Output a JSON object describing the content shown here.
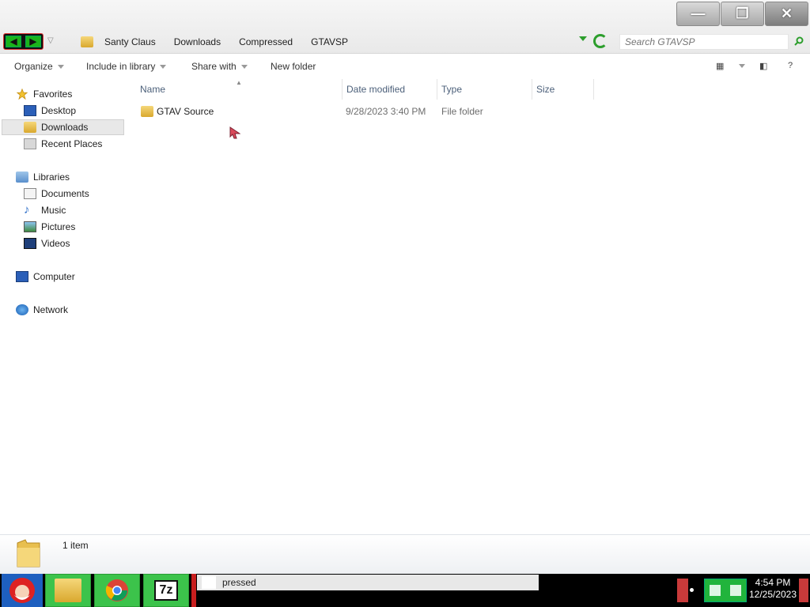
{
  "address_bar": {
    "breadcrumbs": [
      "Santy Claus",
      "Downloads",
      "Compressed",
      "GTAVSP"
    ],
    "search_placeholder": "Search GTAVSP"
  },
  "window_controls": {
    "minimize": "—",
    "restore": "❐",
    "close": "✕"
  },
  "nav_buttons": {
    "back": "◀",
    "forward": "▶"
  },
  "command_bar": {
    "organize": "Organize",
    "include_in_library": "Include in library",
    "share_with": "Share with",
    "new_folder": "New folder",
    "help": "?"
  },
  "navigation": {
    "favorites": {
      "label": "Favorites",
      "items": [
        {
          "label": "Desktop",
          "icon": "desktop-icon"
        },
        {
          "label": "Downloads",
          "icon": "downloads-folder-icon",
          "selected": true
        },
        {
          "label": "Recent Places",
          "icon": "recent-places-icon"
        }
      ]
    },
    "libraries": {
      "label": "Libraries",
      "items": [
        {
          "label": "Documents",
          "icon": "documents-icon"
        },
        {
          "label": "Music",
          "icon": "music-icon"
        },
        {
          "label": "Pictures",
          "icon": "pictures-icon"
        },
        {
          "label": "Videos",
          "icon": "videos-icon"
        }
      ]
    },
    "computer": "Computer",
    "network": "Network"
  },
  "file_list": {
    "columns": [
      "Name",
      "Date modified",
      "Type",
      "Size"
    ],
    "rows": [
      {
        "name": "GTAV Source",
        "date_modified": "9/28/2023 3:40 PM",
        "type": "File folder",
        "size": ""
      }
    ]
  },
  "details_pane": {
    "item_count": "1 item"
  },
  "taskbar": {
    "preview_text": "pressed",
    "clock_time": "4:54 PM",
    "clock_date": "12/25/2023",
    "sevenzip_label": "7z"
  },
  "colors": {
    "accent_green": "#3cc34b",
    "taskbar_red": "#c81e1e",
    "header_text": "#4c607a"
  }
}
